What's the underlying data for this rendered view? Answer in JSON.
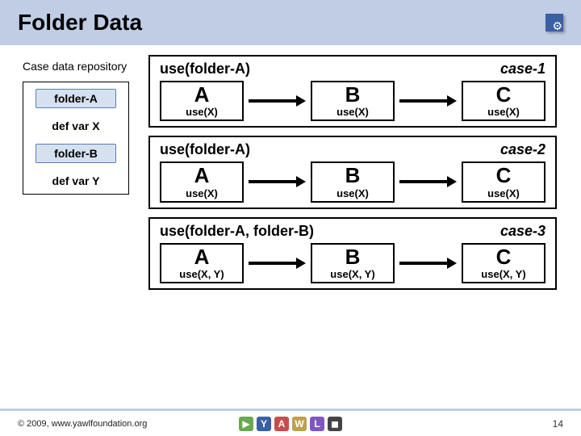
{
  "header": {
    "title": "Folder Data"
  },
  "repository": {
    "label": "Case data repository",
    "items": [
      {
        "kind": "folder",
        "text": "folder-A"
      },
      {
        "kind": "var",
        "text": "def var X"
      },
      {
        "kind": "folder",
        "text": "folder-B"
      },
      {
        "kind": "var",
        "text": "def var Y"
      }
    ]
  },
  "cases": [
    {
      "label": "case-1",
      "use": "use(folder-A)",
      "nodes": [
        {
          "letter": "A",
          "sub": "use(X)"
        },
        {
          "letter": "B",
          "sub": "use(X)"
        },
        {
          "letter": "C",
          "sub": "use(X)"
        }
      ]
    },
    {
      "label": "case-2",
      "use": "use(folder-A)",
      "nodes": [
        {
          "letter": "A",
          "sub": "use(X)"
        },
        {
          "letter": "B",
          "sub": "use(X)"
        },
        {
          "letter": "C",
          "sub": "use(X)"
        }
      ]
    },
    {
      "label": "case-3",
      "use": "use(folder-A, folder-B)",
      "nodes": [
        {
          "letter": "A",
          "sub": "use(X, Y)"
        },
        {
          "letter": "B",
          "sub": "use(X, Y)"
        },
        {
          "letter": "C",
          "sub": "use(X, Y)"
        }
      ]
    }
  ],
  "footer": {
    "copyright": "© 2009, www.yawlfoundation.org",
    "page": "14",
    "logo_letters": [
      "Y",
      "A",
      "W",
      "L"
    ]
  }
}
